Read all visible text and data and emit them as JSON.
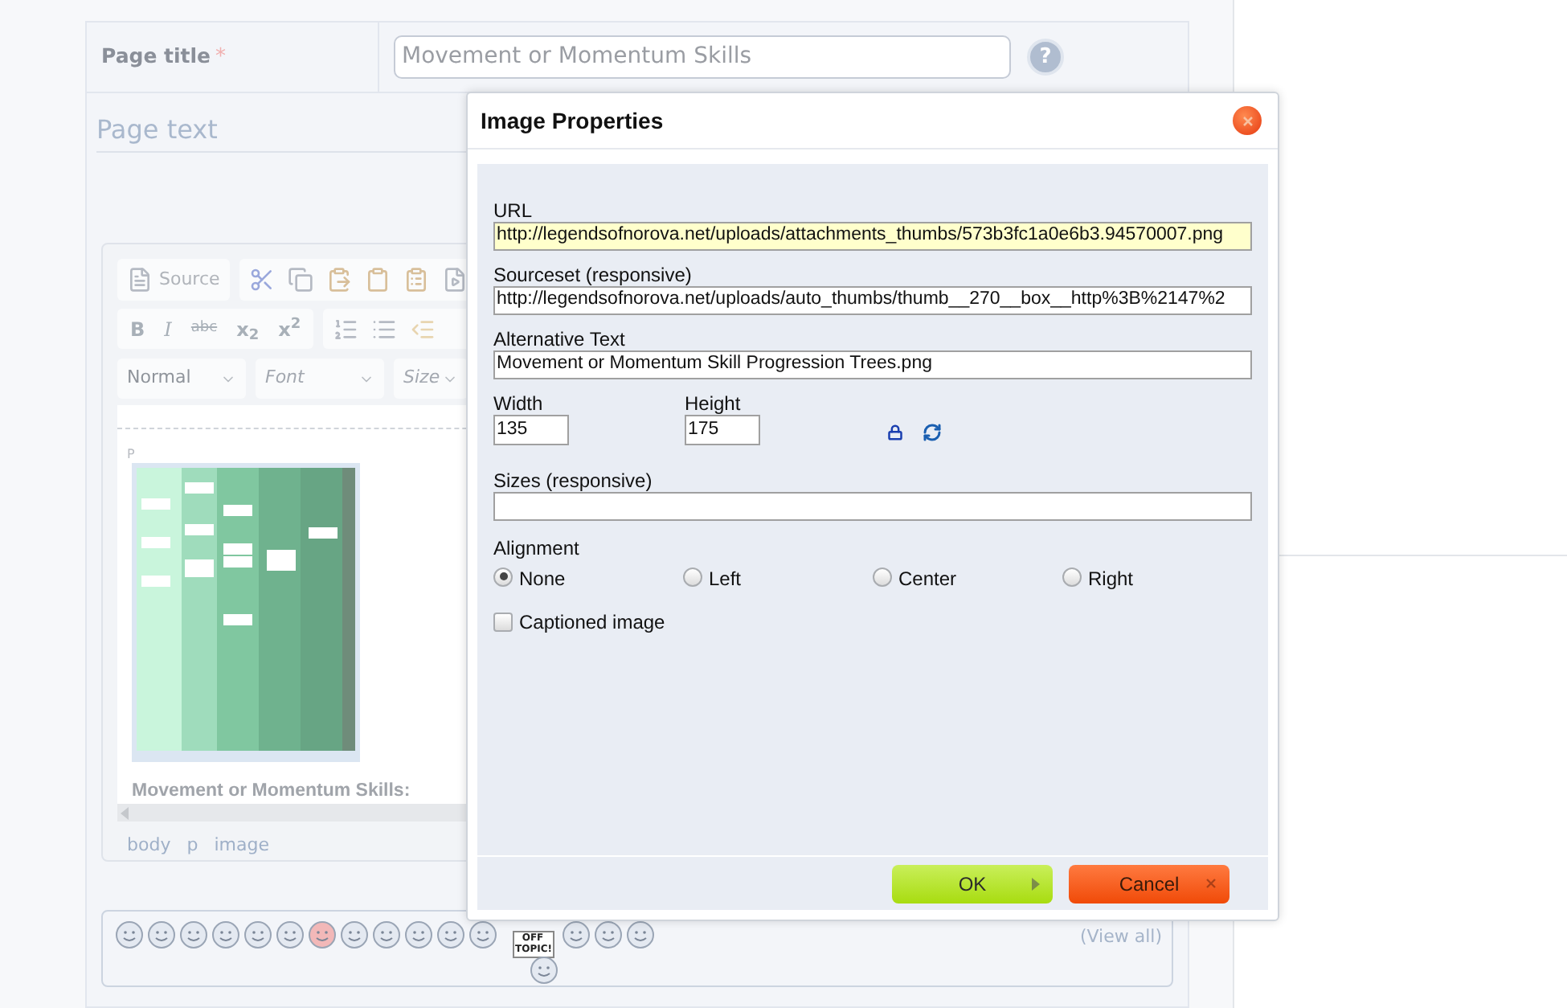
{
  "page_form": {
    "title_label": "Page title",
    "required_mark": "*",
    "title_value": "Movement or Momentum Skills",
    "help": "?",
    "page_text_label": "Page text"
  },
  "editor": {
    "source_button": "Source",
    "format_buttons": [
      "B",
      "I",
      "abc",
      "x$_{2}$",
      "x$^{2}$"
    ],
    "dropdowns": [
      {
        "text": "Normal",
        "kind": "value"
      },
      {
        "text": "Font",
        "kind": "placeholder"
      },
      {
        "text": "Size",
        "kind": "placeholder"
      }
    ],
    "block_marker": "P",
    "heading": "Movement or Momentum Skills:",
    "path": [
      "body",
      "p",
      "image"
    ]
  },
  "smilies": {
    "sign_text": "OFF TOPIC!",
    "view_all": "(View all)"
  },
  "dialog": {
    "title": "Image Properties",
    "fields": [
      {
        "label": "URL",
        "value": "http://legendsofnorova.net/uploads/attachments_thumbs/573b3fc1a0e6b3.94570007.png",
        "highlighted": true
      },
      {
        "label": "Sourceset (responsive)",
        "value": "http://legendsofnorova.net/uploads/auto_thumbs/thumb__270__box__http%3B%2147%2",
        "highlighted": false
      },
      {
        "label": "Alternative Text",
        "value": "Movement or Momentum Skill Progression Trees.png",
        "highlighted": false
      }
    ],
    "width": {
      "label": "Width",
      "value": "135"
    },
    "height": {
      "label": "Height",
      "value": "175"
    },
    "sizes": {
      "label": "Sizes (responsive)"
    },
    "alignment": {
      "label": "Alignment",
      "options": [
        {
          "label": "None",
          "selected": true
        },
        {
          "label": "Left",
          "selected": false
        },
        {
          "label": "Center",
          "selected": false
        },
        {
          "label": "Right",
          "selected": false
        }
      ]
    },
    "captioned": {
      "label": "Captioned image",
      "checked": false
    },
    "buttons": [
      {
        "label": "OK",
        "kind": "ok"
      },
      {
        "label": "Cancel",
        "kind": "cancel"
      }
    ]
  }
}
